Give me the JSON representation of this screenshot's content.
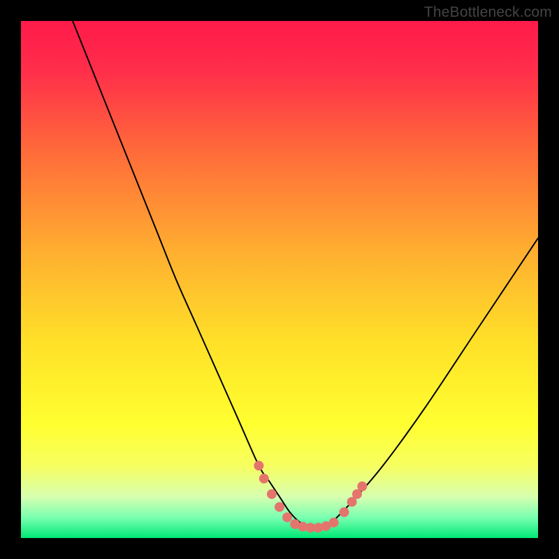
{
  "watermark": "TheBottleneck.com",
  "colors": {
    "gradient_stops": [
      {
        "offset": 0.0,
        "color": "#ff1a4a"
      },
      {
        "offset": 0.1,
        "color": "#ff2f4a"
      },
      {
        "offset": 0.25,
        "color": "#ff6a3a"
      },
      {
        "offset": 0.45,
        "color": "#ffb030"
      },
      {
        "offset": 0.62,
        "color": "#ffe028"
      },
      {
        "offset": 0.78,
        "color": "#ffff30"
      },
      {
        "offset": 0.86,
        "color": "#f7ff60"
      },
      {
        "offset": 0.92,
        "color": "#d8ffb0"
      },
      {
        "offset": 0.96,
        "color": "#7affb0"
      },
      {
        "offset": 1.0,
        "color": "#00e876"
      }
    ],
    "curve_stroke": "#000000",
    "marker_fill": "#e4756d",
    "frame_bg": "#000000"
  },
  "chart_data": {
    "type": "line",
    "title": "",
    "xlabel": "",
    "ylabel": "",
    "xlim": [
      0,
      100
    ],
    "ylim": [
      0,
      100
    ],
    "grid": false,
    "legend": false,
    "series": [
      {
        "name": "bottleneck-curve",
        "x": [
          10,
          14,
          18,
          22,
          26,
          30,
          34,
          38,
          42,
          46,
          48,
          50,
          52,
          54,
          56,
          58,
          60,
          64,
          70,
          78,
          88,
          100
        ],
        "y": [
          100,
          90,
          80,
          70,
          60,
          50,
          41,
          32,
          23,
          14,
          11,
          8,
          5,
          3,
          2,
          2,
          3,
          7,
          14,
          25,
          40,
          58
        ]
      }
    ],
    "markers": [
      {
        "x": 46.0,
        "y": 14.0
      },
      {
        "x": 47.0,
        "y": 11.5
      },
      {
        "x": 48.5,
        "y": 8.5
      },
      {
        "x": 50.0,
        "y": 6.0
      },
      {
        "x": 51.5,
        "y": 4.0
      },
      {
        "x": 53.0,
        "y": 2.7
      },
      {
        "x": 54.5,
        "y": 2.2
      },
      {
        "x": 56.0,
        "y": 2.0
      },
      {
        "x": 57.5,
        "y": 2.0
      },
      {
        "x": 59.0,
        "y": 2.3
      },
      {
        "x": 60.5,
        "y": 3.0
      },
      {
        "x": 62.5,
        "y": 5.0
      },
      {
        "x": 64.0,
        "y": 7.0
      },
      {
        "x": 65.0,
        "y": 8.5
      },
      {
        "x": 66.0,
        "y": 10.0
      }
    ],
    "annotations": []
  }
}
